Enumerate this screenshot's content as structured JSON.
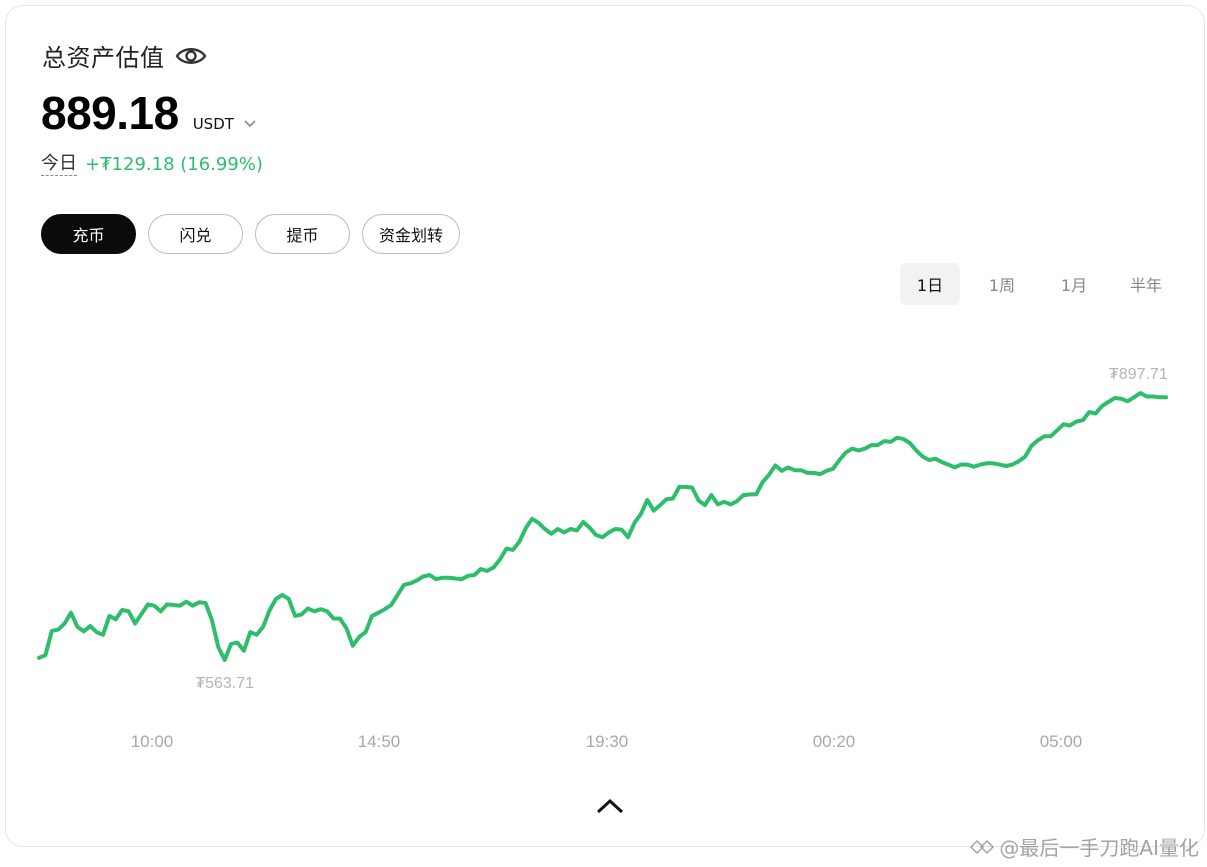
{
  "header": {
    "title": "总资产估值",
    "total_value": "889.18",
    "currency": "USDT"
  },
  "today": {
    "label": "今日",
    "change": "+₮129.18 (16.99%)"
  },
  "actions": [
    "充币",
    "闪兑",
    "提币",
    "资金划转"
  ],
  "ranges": [
    "1日",
    "1周",
    "1月",
    "半年"
  ],
  "active_range": "1日",
  "chart_data": {
    "type": "line",
    "x_ticks": [
      "10:00",
      "14:50",
      "19:30",
      "00:20",
      "05:00"
    ],
    "min_label": "₮563.71",
    "max_label": "₮897.71",
    "min_value": 563.71,
    "max_value": 897.71,
    "line_color": "#2ebd6b",
    "values": [
      566.3,
      569.7,
      600.1,
      601.8,
      609.4,
      622.9,
      605.3,
      599.5,
      606.3,
      598.6,
      595.2,
      618.9,
      614.6,
      626.4,
      624.6,
      609.4,
      621.3,
      633.3,
      631.6,
      624.6,
      633.3,
      632.5,
      631.6,
      636.7,
      631.6,
      635.9,
      635.0,
      613.9,
      579.9,
      563.7,
      583.8,
      585.5,
      575.3,
      598.6,
      595.2,
      605.3,
      625.6,
      640.1,
      645.2,
      640.1,
      618.9,
      620.6,
      628.2,
      624.6,
      627.3,
      624.6,
      615.5,
      615.5,
      603.5,
      581.6,
      592.6,
      598.6,
      618.9,
      622.9,
      627.3,
      632.5,
      645.2,
      657.8,
      659.6,
      663.1,
      668.2,
      670.1,
      664.8,
      666.5,
      666.5,
      665.6,
      664.8,
      669.1,
      670.1,
      677.6,
      675.2,
      679.4,
      689.5,
      703.0,
      701.4,
      711.5,
      728.4,
      740.4,
      735.4,
      727.6,
      721.6,
      727.6,
      723.3,
      727.6,
      725.8,
      736.3,
      729.2,
      719.9,
      717.3,
      723.3,
      727.6,
      726.7,
      717.3,
      735.4,
      746.3,
      764.0,
      750.6,
      757.5,
      764.8,
      765.7,
      780.2,
      780.2,
      779.4,
      763.2,
      757.5,
      770.0,
      758.4,
      761.6,
      758.4,
      762.4,
      770.0,
      770.9,
      770.9,
      786.1,
      795.4,
      807.2,
      800.4,
      804.6,
      801.2,
      801.2,
      797.8,
      797.8,
      796.2,
      800.4,
      802.9,
      813.9,
      823.2,
      828.2,
      825.8,
      828.2,
      832.5,
      832.5,
      837.5,
      836.7,
      841.8,
      840.0,
      835.0,
      825.8,
      818.2,
      813.9,
      815.5,
      811.3,
      808.1,
      804.6,
      808.1,
      808.1,
      805.5,
      808.1,
      809.8,
      809.8,
      808.1,
      806.4,
      808.1,
      812.3,
      818.2,
      831.6,
      838.5,
      843.5,
      843.5,
      851.1,
      858.6,
      857.0,
      862.1,
      863.7,
      873.8,
      872.1,
      881.4,
      886.4,
      891.5,
      890.6,
      887.3,
      892.3,
      897.7,
      893.3,
      893.3,
      892.3,
      892.3
    ]
  },
  "watermark": "@最后一手刀跑AI量化"
}
